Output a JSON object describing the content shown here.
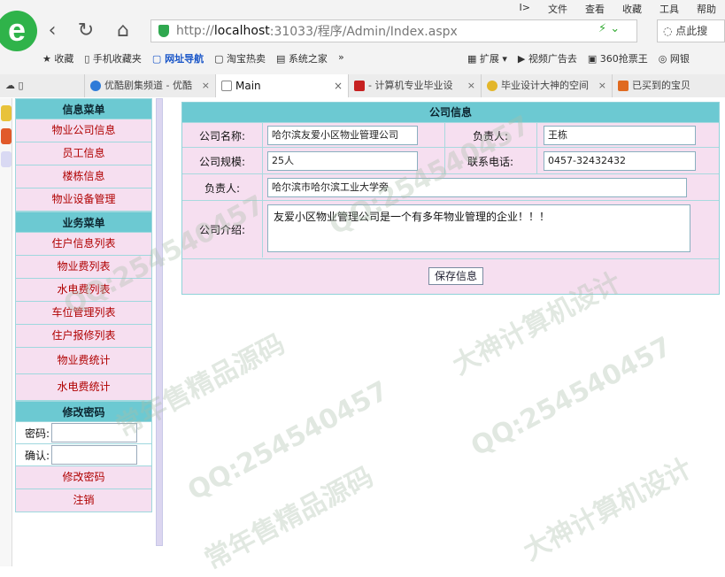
{
  "browser": {
    "menu": [
      "文件",
      "查看",
      "收藏",
      "工具",
      "帮助"
    ],
    "menu_prefix": "I>",
    "url_prefix": "http://",
    "url_host": "localhost",
    "url_rest": ":31033/程序/Admin/Index.aspx",
    "search_text": "点此搜",
    "bookmarks": [
      "收藏",
      "手机收藏夹",
      "网址导航",
      "淘宝热卖",
      "系统之家",
      "»"
    ],
    "bookmarks_right": [
      "扩展",
      "视频广告去",
      "360抢票王",
      "网银"
    ],
    "tabs": [
      {
        "label": "优酷剧集频道 - 优酷",
        "close": "×"
      },
      {
        "label": "Main",
        "close": "×"
      },
      {
        "label": "- 计算机专业毕业设",
        "close": "×"
      },
      {
        "label": "毕业设计大神的空间",
        "close": "×"
      },
      {
        "label": "已买到的宝贝",
        "close": ""
      }
    ]
  },
  "sidebar": {
    "sections": [
      {
        "title": "信息菜单",
        "items": [
          "物业公司信息",
          "员工信息",
          "楼栋信息",
          "物业设备管理"
        ]
      },
      {
        "title": "业务菜单",
        "items": [
          "住户信息列表",
          "物业费列表",
          "水电费列表",
          "车位管理列表",
          "住户报修列表",
          "物业费统计",
          "水电费统计"
        ]
      }
    ],
    "password_section": {
      "title": "修改密码",
      "password_label": "密码:",
      "confirm_label": "确认:",
      "change_button": "修改密码",
      "logout_button": "注销"
    }
  },
  "company": {
    "title": "公司信息",
    "name_label": "公司名称:",
    "name_value": "哈尔滨友爱小区物业管理公司",
    "manager_label": "负责人:",
    "manager_value": "王栋",
    "scale_label": "公司规模:",
    "scale_value": "25人",
    "phone_label": "联系电话:",
    "phone_value": "0457-32432432",
    "address_label": "负责人:",
    "address_value": "哈尔滨市哈尔滨工业大学旁",
    "intro_label": "公司介绍:",
    "intro_value": "友爱小区物业管理公司是一个有多年物业管理的企业！！！",
    "save_button": "保存信息"
  },
  "watermarks": [
    "QQ:254540457",
    "常年售精品源码",
    "大神计算机设计",
    "QQ:254540457",
    "常年售精品源码",
    "大神计算机设计",
    "QQ:254540457",
    "QQ:254540457"
  ],
  "colors": {
    "header_teal": "#6cc9d2",
    "row_pink": "#f6dff0",
    "menu_text": "#b00000"
  }
}
